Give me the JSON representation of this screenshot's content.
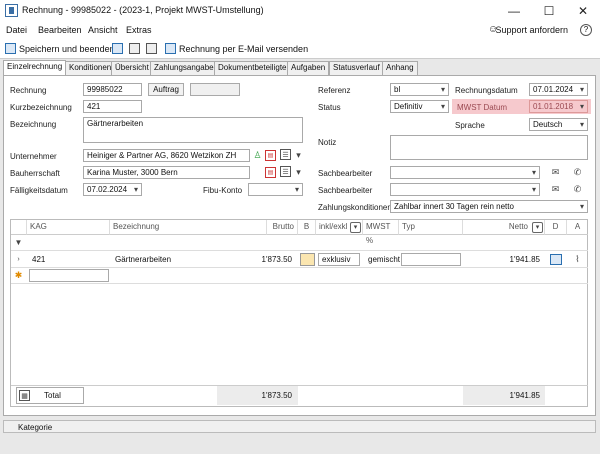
{
  "window": {
    "title": "Rechnung - 99985022 - (2023-1, Projekt MWST-Umstellung)",
    "minimize": "—",
    "maximize": "☐",
    "close": "✕"
  },
  "menu": {
    "items": [
      "Datei",
      "Bearbeiten",
      "Ansicht",
      "Extras"
    ],
    "support": "Support anfordern",
    "help": "?"
  },
  "toolbar": {
    "save_close": "Speichern und beenden",
    "email": "Rechnung per E-Mail versenden"
  },
  "tabs": [
    "Einzelrechnung",
    "Konditionen",
    "Übersicht",
    "Zahlungsangaben",
    "Dokumentbeteiligte",
    "Aufgaben",
    "Statusverlauf",
    "Anhang"
  ],
  "form": {
    "rechnung_label": "Rechnung",
    "rechnung_value": "99985022",
    "auftrag_button": "Auftrag",
    "kurz_label": "Kurzbezeichnung",
    "kurz_value": "421",
    "bez_label": "Bezeichnung",
    "bez_value": "Gärtnerarbeiten",
    "unternehmer_label": "Unternehmer",
    "unternehmer_value": "Heiniger & Partner AG, 8620 Wetzikon ZH",
    "bauherr_label": "Bauherrschaft",
    "bauherr_value": "Karina Muster, 3000 Bern",
    "faellig_label": "Fälligkeitsdatum",
    "faellig_value": "07.02.2024",
    "fibu_label": "Fibu-Konto",
    "fibu_value": "",
    "referenz_label": "Referenz",
    "referenz_value": "bl",
    "status_label": "Status",
    "status_value": "Definitiv",
    "rdatum_label": "Rechnungsdatum",
    "rdatum_value": "07.01.2024",
    "mwst_label": "MWST Datum",
    "mwst_value": "01.01.2018",
    "sprache_label": "Sprache",
    "sprache_value": "Deutsch",
    "notiz_label": "Notiz",
    "sach1_label": "Sachbearbeiter",
    "sach2_label": "Sachbearbeiter",
    "zk_label": "Zahlungskonditionen",
    "zk_value": "Zahlbar innert 30 Tagen rein netto"
  },
  "grid": {
    "headers": [
      "KAG",
      "Bezeichnung",
      "Brutto",
      "B",
      "inkl/exkl",
      "MWST %",
      "Typ",
      "Netto",
      "D",
      "A"
    ],
    "row": {
      "kag": "421",
      "bez": "Gärtnerarbeiten",
      "brutto": "1'873.50",
      "inkl": "exklusiv",
      "mwst": "gemischt",
      "netto": "1'941.85"
    },
    "total_label": "Total",
    "total_brutto": "1'873.50",
    "total_netto": "1'941.85"
  },
  "statusbar": {
    "kategorie": "Kategorie"
  },
  "colors": {
    "highlight": "#f6c9cd",
    "accent": "#2a6fb0"
  }
}
